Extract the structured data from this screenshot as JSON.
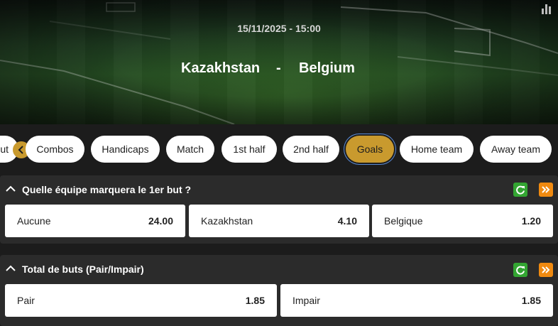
{
  "header": {
    "datetime": "15/11/2025 - 15:00",
    "home_team": "Kazakhstan",
    "separator": "-",
    "away_team": "Belgium",
    "stats_icon": "bar-chart-icon"
  },
  "tabs": {
    "partial_label": "ut",
    "prev_icon": "chevron-left-icon",
    "items": [
      {
        "label": "Combos"
      },
      {
        "label": "Handicaps"
      },
      {
        "label": "Match"
      },
      {
        "label": "1st half"
      },
      {
        "label": "2nd half"
      },
      {
        "label": "Goals",
        "active": true
      },
      {
        "label": "Home team"
      },
      {
        "label": "Away team"
      }
    ]
  },
  "markets": [
    {
      "title": "Quelle équipe marquera le 1er but ?",
      "outcomes": [
        {
          "label": "Aucune",
          "price": "24.00"
        },
        {
          "label": "Kazakhstan",
          "price": "4.10"
        },
        {
          "label": "Belgique",
          "price": "1.20"
        }
      ]
    },
    {
      "title": "Total de buts (Pair/Impair)",
      "outcomes": [
        {
          "label": "Pair",
          "price": "1.85"
        },
        {
          "label": "Impair",
          "price": "1.85"
        }
      ]
    }
  ],
  "colors": {
    "accent": "#c99a2e",
    "refresh": "#33a532",
    "expand": "#f08a10",
    "panel": "#2b2b2b",
    "background": "#1c1c1c"
  }
}
